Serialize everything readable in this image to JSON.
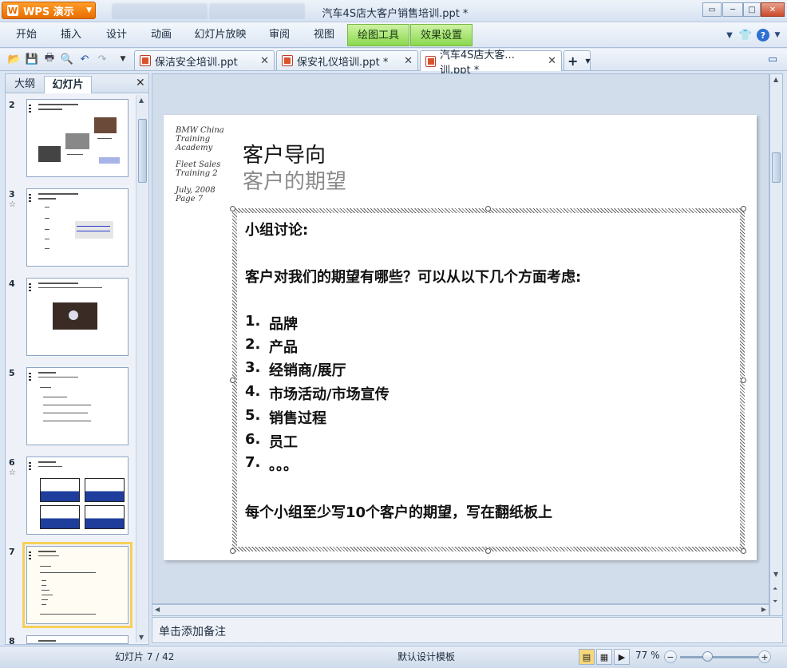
{
  "app": {
    "name": "WPS 演示",
    "window_title": "汽车4S店大客户销售培训.ppt *"
  },
  "menu": [
    "开始",
    "插入",
    "设计",
    "动画",
    "幻灯片放映",
    "审阅",
    "视图"
  ],
  "context_menus": [
    "绘图工具",
    "效果设置"
  ],
  "tabs": [
    {
      "label": "保洁安全培训.ppt",
      "active": false
    },
    {
      "label": "保安礼仪培训.ppt *",
      "active": false
    },
    {
      "label": "汽车4S店大客...训.ppt *",
      "active": true
    }
  ],
  "panel": {
    "tab_outline": "大纲",
    "tab_slides": "幻灯片",
    "thumbnails": [
      "2",
      "3",
      "4",
      "5",
      "6",
      "7",
      "8"
    ],
    "selected": "7"
  },
  "slide": {
    "side_text": [
      "BMW China",
      "Training",
      "Academy",
      "Fleet Sales",
      "Training 2",
      "July, 2008",
      "Page 7"
    ],
    "title": "客户导向",
    "subtitle": "客户的期望",
    "discussion": "小组讨论:",
    "question": "客户对我们的期望有哪些？可以从以下几个方面考虑:",
    "items": [
      {
        "num": "1.",
        "text": "品牌"
      },
      {
        "num": "2.",
        "text": "产品"
      },
      {
        "num": "3.",
        "text": "经销商/展厅"
      },
      {
        "num": "4.",
        "text": "市场活动/市场宣传"
      },
      {
        "num": "5.",
        "text": "销售过程"
      },
      {
        "num": "6.",
        "text": "员工"
      },
      {
        "num": "7.",
        "text": "。。。"
      }
    ],
    "footer": "每个小组至少写10个客户的期望，写在翻纸板上"
  },
  "notes_placeholder": "单击添加备注",
  "status": {
    "slide_counter": "幻灯片 7 / 42",
    "template": "默认设计模板",
    "zoom": "77 %"
  }
}
